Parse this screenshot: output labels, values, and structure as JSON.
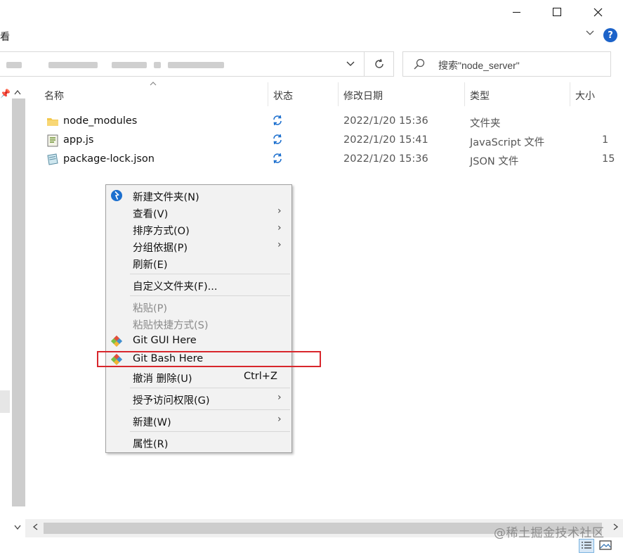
{
  "ribbon": {
    "view_label": "看",
    "help": "?"
  },
  "search": {
    "placeholder": "搜索\"node_server\""
  },
  "columns": {
    "name": "名称",
    "status": "状态",
    "modified": "修改日期",
    "type": "类型",
    "size": "大小"
  },
  "files": [
    {
      "name": "node_modules",
      "status_icon": "sync-icon",
      "modified": "2022/1/20 15:36",
      "type": "文件夹",
      "size": ""
    },
    {
      "name": "app.js",
      "status_icon": "sync-icon",
      "modified": "2022/1/20 15:41",
      "type": "JavaScript 文件",
      "size": "1"
    },
    {
      "name": "package-lock.json",
      "status_icon": "sync-icon",
      "modified": "2022/1/20 15:36",
      "type": "JSON 文件",
      "size": "15"
    }
  ],
  "context_menu": {
    "new_folder": "新建文件夹(N)",
    "view": "查看(V)",
    "sort_by": "排序方式(O)",
    "group_by": "分组依据(P)",
    "refresh": "刷新(E)",
    "customize": "自定义文件夹(F)...",
    "paste": "粘贴(P)",
    "paste_shortcut": "粘贴快捷方式(S)",
    "git_gui": "Git GUI Here",
    "git_bash": "Git Bash Here",
    "undo_delete": "撤消 删除(U)",
    "undo_shortcut": "Ctrl+Z",
    "give_access": "授予访问权限(G)",
    "new": "新建(W)",
    "properties": "属性(R)"
  },
  "watermark": "@稀土掘金技术社区",
  "colors": {
    "highlight_border": "#d8262c",
    "accent": "#1c63c9"
  }
}
